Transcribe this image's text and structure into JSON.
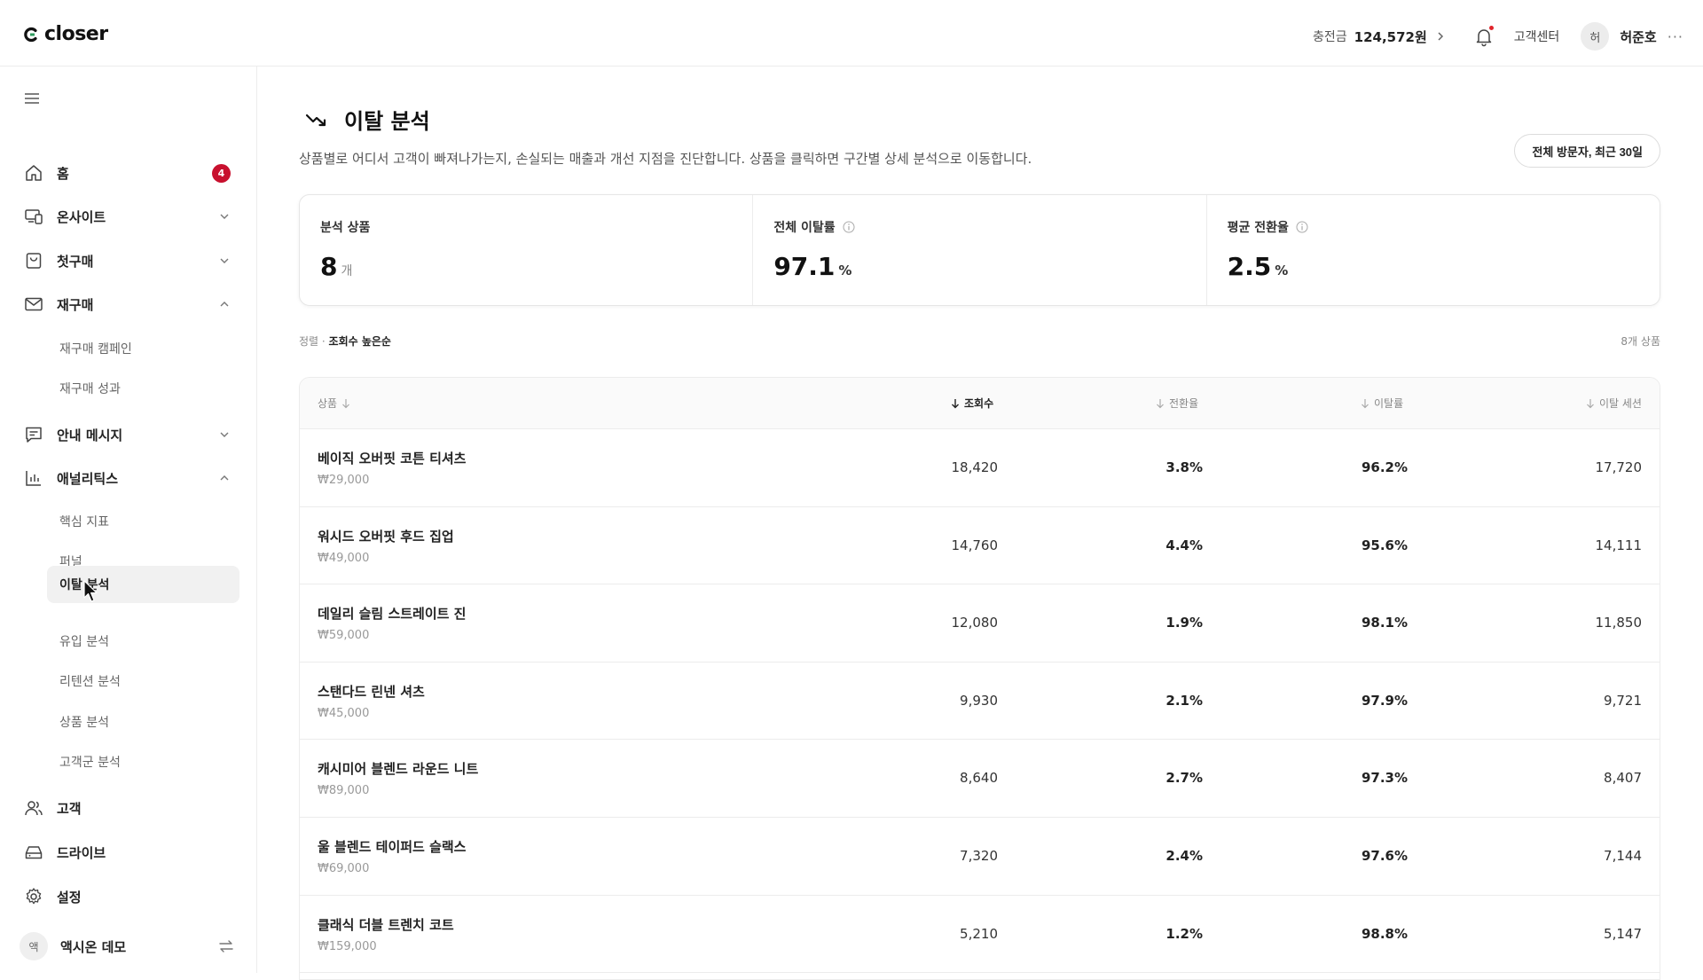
{
  "app": {
    "brand": "closer"
  },
  "topbar": {
    "balance_label": "충전금",
    "balance_value": "124,572원",
    "support": "고객센터",
    "avatar_initial": "허",
    "username": "허준호",
    "more": "···"
  },
  "sidebar": {
    "home": {
      "label": "홈",
      "badge": "4"
    },
    "onsite": "온사이트",
    "first_purchase": "첫구매",
    "repurchase": "재구매",
    "repurchase_sub": [
      "재구매 캠페인",
      "재구매 성과"
    ],
    "messages": "안내 메시지",
    "analytics": "애널리틱스",
    "analytics_sub": [
      "핵심 지표",
      "퍼널",
      "이탈 분석",
      "유입 분석",
      "리텐션 분석",
      "상품 분석",
      "고객군 분석"
    ],
    "analytics_active": "이탈 분석",
    "customers": "고객",
    "drive": "드라이브",
    "settings": "설정",
    "workspace": {
      "initial": "액",
      "name": "액시온 데모"
    }
  },
  "page": {
    "title": "이탈 분석",
    "description": "상품별로 어디서 고객이 빠져나가는지, 손실되는 매출과 개선 지점을 진단합니다. 상품을 클릭하면 구간별 상세 분석으로 이동합니다.",
    "filter": "전체 방문자, 최근 30일"
  },
  "kpis": {
    "products": {
      "label": "분석 상품",
      "value": "8",
      "unit": "개"
    },
    "churn": {
      "label": "전체 이탈률",
      "value": "97.1",
      "unit": "%"
    },
    "conversion": {
      "label": "평균 전환율",
      "value": "2.5",
      "unit": "%"
    }
  },
  "list": {
    "sort_label": "정렬 · ",
    "sort_value": "조회수 높은순",
    "count": "8개 상품"
  },
  "table": {
    "headers": {
      "product": "상품",
      "views": "조회수",
      "conversion": "전환율",
      "churn": "이탈률",
      "churn_sessions": "이탈 세션"
    },
    "rows": [
      {
        "name": "베이직 오버핏 코튼 티셔츠",
        "price": "₩29,000",
        "views": "18,420",
        "conversion": "3.8%",
        "churn": "96.2%",
        "sessions": "17,720"
      },
      {
        "name": "워시드 오버핏 후드 집업",
        "price": "₩49,000",
        "views": "14,760",
        "conversion": "4.4%",
        "churn": "95.6%",
        "sessions": "14,111"
      },
      {
        "name": "데일리 슬림 스트레이트 진",
        "price": "₩59,000",
        "views": "12,080",
        "conversion": "1.9%",
        "churn": "98.1%",
        "sessions": "11,850"
      },
      {
        "name": "스탠다드 린넨 셔츠",
        "price": "₩45,000",
        "views": "9,930",
        "conversion": "2.1%",
        "churn": "97.9%",
        "sessions": "9,721"
      },
      {
        "name": "캐시미어 블렌드 라운드 니트",
        "price": "₩89,000",
        "views": "8,640",
        "conversion": "2.7%",
        "churn": "97.3%",
        "sessions": "8,407"
      },
      {
        "name": "울 블렌드 테이퍼드 슬랙스",
        "price": "₩69,000",
        "views": "7,320",
        "conversion": "2.4%",
        "churn": "97.6%",
        "sessions": "7,144"
      },
      {
        "name": "클래식 더블 트렌치 코트",
        "price": "₩159,000",
        "views": "5,210",
        "conversion": "1.2%",
        "churn": "98.8%",
        "sessions": "5,147"
      }
    ]
  },
  "colors": {
    "badge": "#c8102e",
    "notification_dot": "#e0242b",
    "active_nav_bg": "#f1f1f1"
  }
}
